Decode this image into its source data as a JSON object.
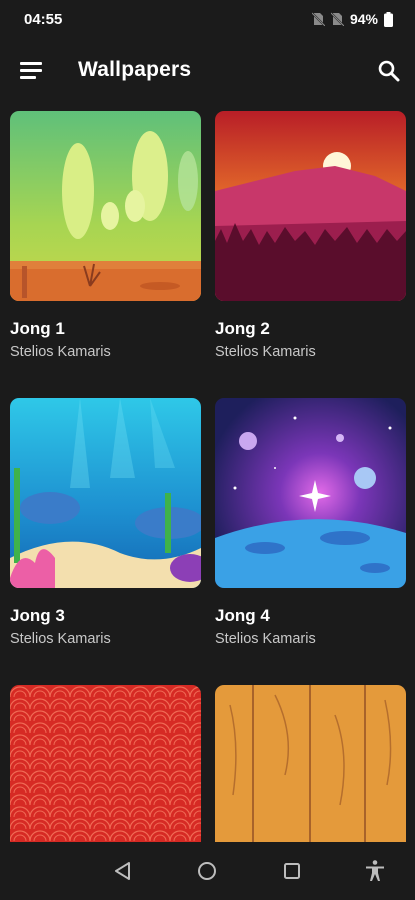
{
  "status": {
    "time": "04:55",
    "battery": "94%"
  },
  "appbar": {
    "title": "Wallpapers"
  },
  "wallpapers": [
    {
      "name": "Jong 1",
      "author": "Stelios Kamaris"
    },
    {
      "name": "Jong 2",
      "author": "Stelios Kamaris"
    },
    {
      "name": "Jong 3",
      "author": "Stelios Kamaris"
    },
    {
      "name": "Jong 4",
      "author": "Stelios Kamaris"
    },
    {
      "name": "",
      "author": ""
    },
    {
      "name": "",
      "author": ""
    }
  ],
  "icons": {
    "menu": "menu-icon",
    "search": "search-icon",
    "back": "back-triangle-icon",
    "home": "home-circle-icon",
    "recents": "recents-square-icon",
    "accessibility": "accessibility-icon"
  },
  "colors": {
    "background": "#1b1b1b",
    "text": "#ffffff",
    "secondary_text": "#c8c8c8"
  }
}
